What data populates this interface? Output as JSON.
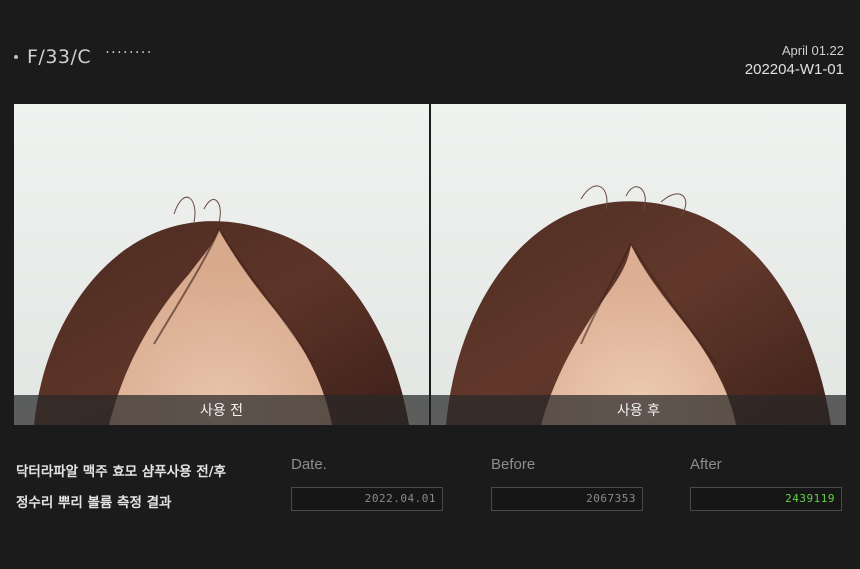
{
  "header": {
    "subject": "F/33/C",
    "dots": "········",
    "date": "April 01.22",
    "code": "202204-W1-01"
  },
  "photos": {
    "before_label": "사용 전",
    "after_label": "사용 후"
  },
  "caption": {
    "line1": "닥터라파알 맥주 효모 샴푸사용 전/후",
    "line2": "정수리 뿌리 볼륨 측정 결과"
  },
  "metrics": {
    "date": {
      "label": "Date.",
      "value": "2022.04.01"
    },
    "before": {
      "label": "Before",
      "value": "2067353"
    },
    "after": {
      "label": "After",
      "value": "2439119"
    }
  },
  "colors": {
    "background": "#1b1b1b",
    "after_value": "#63d04a",
    "label": "#8d8d8d"
  }
}
